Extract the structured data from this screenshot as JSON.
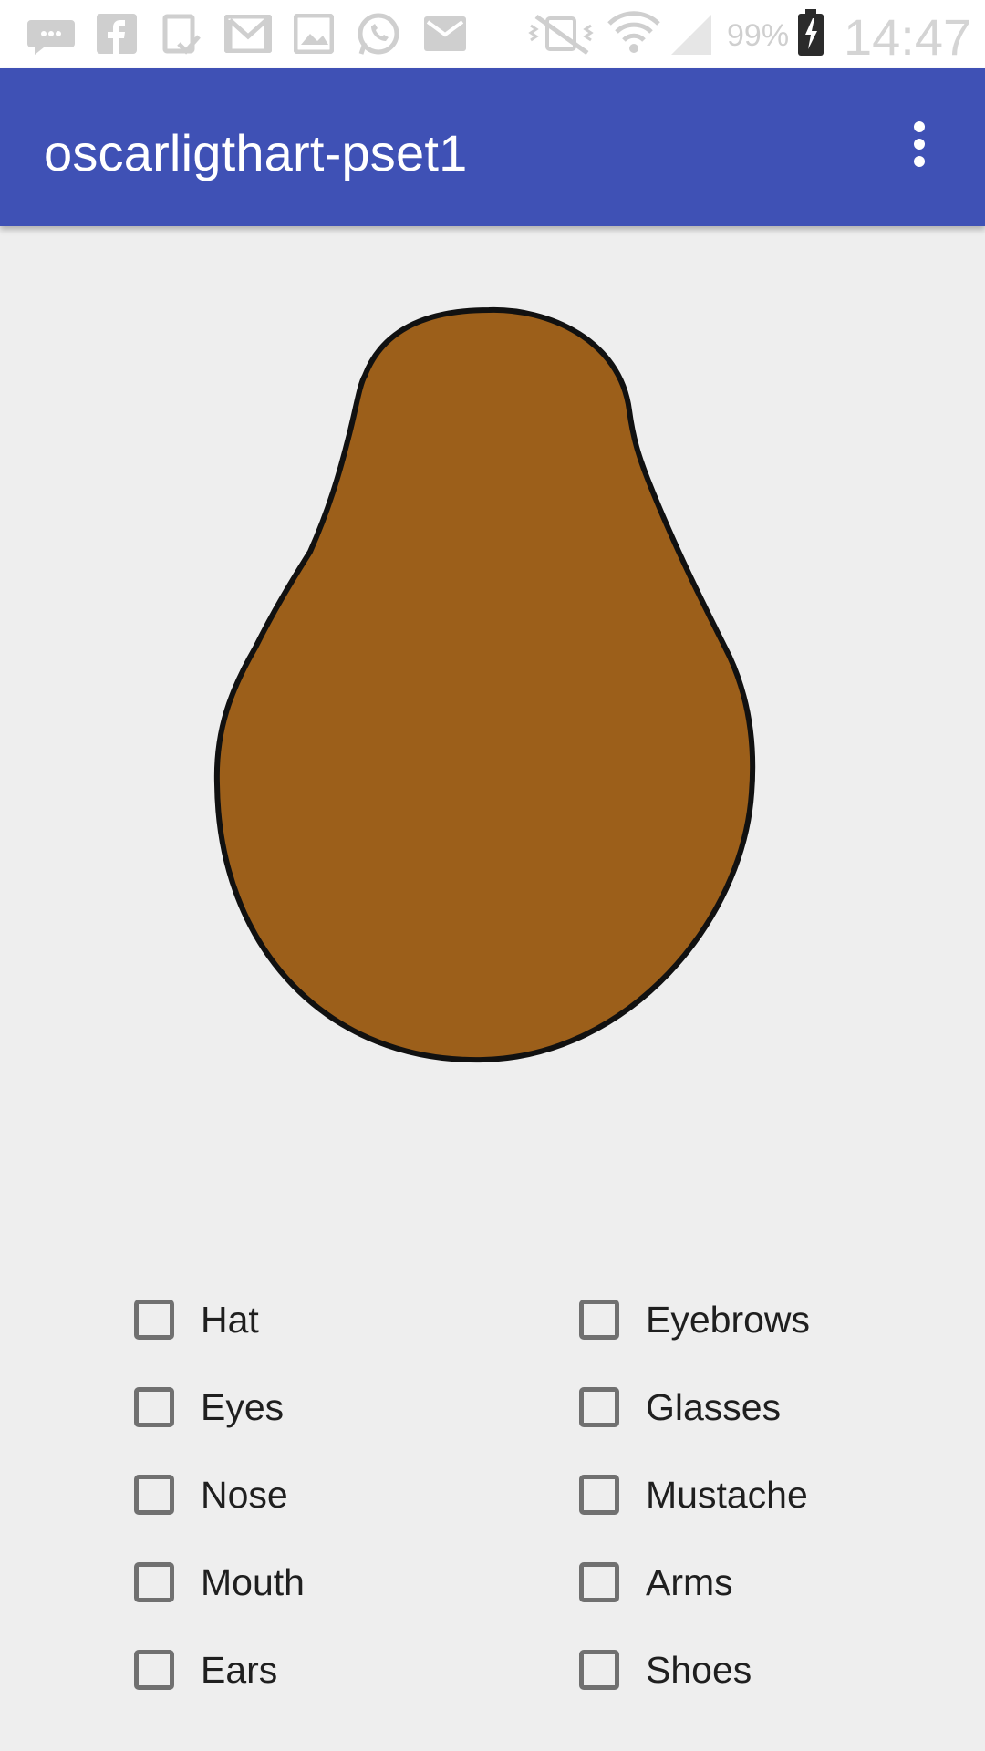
{
  "status_bar": {
    "battery_percent": "99%",
    "time": "14:47",
    "icons": [
      "chat-icon",
      "facebook-icon",
      "clipboard-icon",
      "gmail-icon",
      "gallery-icon",
      "whatsapp-icon",
      "email-icon",
      "vibrate-mute-icon",
      "wifi-icon",
      "signal-icon",
      "battery-charging-icon"
    ]
  },
  "app_bar": {
    "title": "oscarligthart-pset1",
    "overflow_icon": "more-vert-icon",
    "color": "#3f51b5"
  },
  "figure": {
    "name": "potato-body",
    "fill_color": "#9c5f1a"
  },
  "checkboxes": {
    "left": [
      {
        "label": "Hat",
        "checked": false
      },
      {
        "label": "Eyes",
        "checked": false
      },
      {
        "label": "Nose",
        "checked": false
      },
      {
        "label": "Mouth",
        "checked": false
      },
      {
        "label": "Ears",
        "checked": false
      }
    ],
    "right": [
      {
        "label": "Eyebrows",
        "checked": false
      },
      {
        "label": "Glasses",
        "checked": false
      },
      {
        "label": "Mustache",
        "checked": false
      },
      {
        "label": "Arms",
        "checked": false
      },
      {
        "label": "Shoes",
        "checked": false
      }
    ]
  }
}
